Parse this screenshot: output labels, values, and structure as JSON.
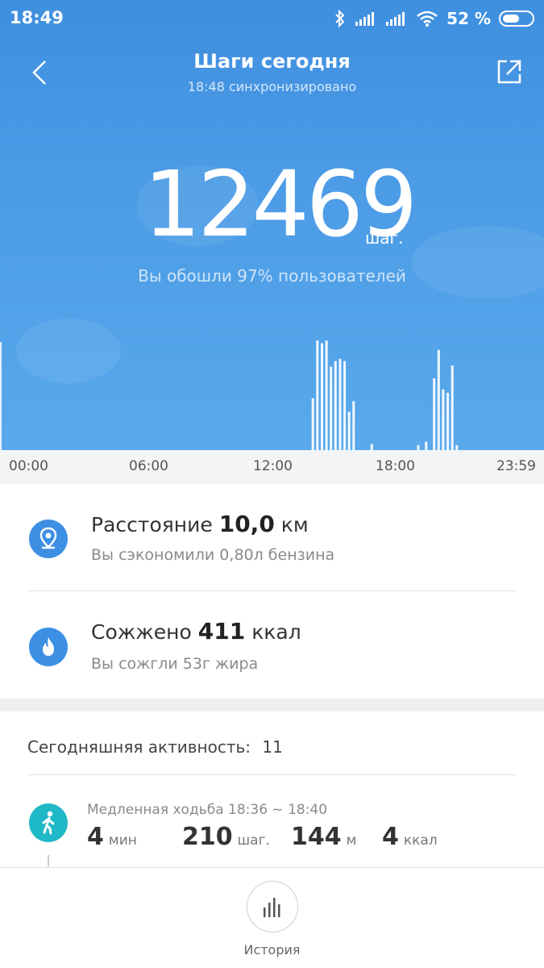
{
  "status_bar": {
    "time": "18:49",
    "battery": "52 %"
  },
  "header": {
    "title": "Шаги сегодня",
    "subtitle": "18:48 синхронизировано"
  },
  "summary": {
    "steps": "12469",
    "steps_unit": "шаг.",
    "rank_text": "Вы обошли 97% пользователей"
  },
  "chart_data": {
    "type": "bar",
    "x_ticks": [
      "00:00",
      "06:00",
      "12:00",
      "18:00",
      "23:59"
    ],
    "x_range_hours": [
      0,
      24
    ],
    "y_max": 1000,
    "bars": [
      {
        "t": 13.75,
        "v": 465
      },
      {
        "t": 13.95,
        "v": 985
      },
      {
        "t": 14.15,
        "v": 960
      },
      {
        "t": 14.35,
        "v": 985
      },
      {
        "t": 14.55,
        "v": 750
      },
      {
        "t": 14.75,
        "v": 800
      },
      {
        "t": 14.95,
        "v": 820
      },
      {
        "t": 15.15,
        "v": 800
      },
      {
        "t": 15.35,
        "v": 345
      },
      {
        "t": 15.55,
        "v": 440
      },
      {
        "t": 16.35,
        "v": 55
      },
      {
        "t": 18.4,
        "v": 45
      },
      {
        "t": 18.75,
        "v": 75
      },
      {
        "t": 19.1,
        "v": 645
      },
      {
        "t": 19.3,
        "v": 900
      },
      {
        "t": 19.5,
        "v": 545
      },
      {
        "t": 19.7,
        "v": 515
      },
      {
        "t": 19.9,
        "v": 760
      },
      {
        "t": 20.1,
        "v": 45
      }
    ],
    "bar_color": "#ffffff"
  },
  "stats": {
    "distance": {
      "label": "Расстояние",
      "value": "10,0",
      "unit": "км",
      "sub": "Вы сэкономили 0,80л бензина",
      "icon": "location-pin-icon"
    },
    "calories": {
      "label": "Сожжено",
      "value": "411",
      "unit": "ккал",
      "sub": "Вы сожгли 53г жира",
      "icon": "flame-icon"
    }
  },
  "activity": {
    "header_label": "Сегодняшняя активность:",
    "count": "11",
    "items": [
      {
        "title": "Медленная ходьба 18:36 ~ 18:40",
        "icon": "walking-person-icon",
        "metrics": [
          {
            "value": "4",
            "unit": "мин"
          },
          {
            "value": "210",
            "unit": "шаг."
          },
          {
            "value": "144",
            "unit": "м"
          },
          {
            "value": "4",
            "unit": "ккал"
          }
        ]
      }
    ]
  },
  "bottom": {
    "history_label": "История"
  },
  "colors": {
    "hero_top": "#3f8fe0",
    "hero_bottom": "#5aa9ec",
    "accent": "#3d8fe4",
    "walk": "#1fb8c7"
  }
}
